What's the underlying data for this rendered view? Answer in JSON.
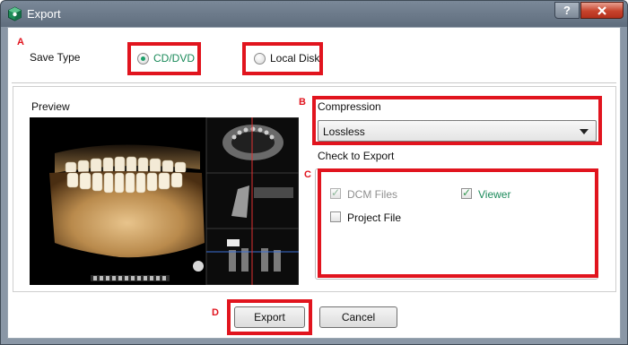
{
  "window": {
    "title": "Export",
    "help_label": "?",
    "close_label": "x",
    "app_icon": "app-cube-icon"
  },
  "annotations": {
    "a": "A",
    "b": "B",
    "c": "C",
    "d": "D",
    "color": "#e1141e"
  },
  "save_type": {
    "label": "Save Type",
    "options": [
      {
        "label": "CD/DVD",
        "selected": true
      },
      {
        "label": "Local Disk",
        "selected": false
      }
    ]
  },
  "preview": {
    "label": "Preview"
  },
  "compression": {
    "label": "Compression",
    "selected": "Lossless"
  },
  "check_to_export": {
    "label": "Check to Export",
    "items": [
      {
        "label": "DCM Files",
        "checked": true,
        "disabled": true
      },
      {
        "label": "Viewer",
        "checked": true,
        "disabled": false
      },
      {
        "label": "Project File",
        "checked": false,
        "disabled": false
      }
    ]
  },
  "buttons": {
    "export": "Export",
    "cancel": "Cancel"
  },
  "colors": {
    "accent_green": "#1b8a5a",
    "titlebar": "#6d7b8c"
  }
}
